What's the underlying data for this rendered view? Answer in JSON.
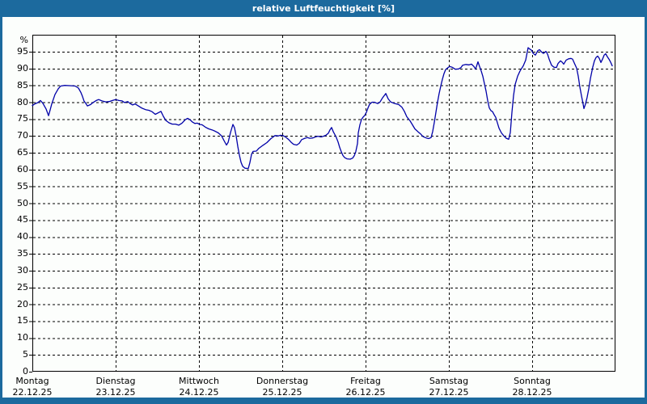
{
  "window": {
    "title": "relative Luftfeuchtigkeit [%]",
    "frame_color": "#1c6a9e",
    "content_background": "#fcfefc"
  },
  "chart_data": {
    "type": "line",
    "title": "relative Luftfeuchtigkeit [%]",
    "unit_label": "%",
    "ylabel": "relative Luftfeuchtigkeit [%]",
    "xlabel": "",
    "ylim": [
      0,
      100
    ],
    "y_ticks": [
      0,
      5,
      10,
      15,
      20,
      25,
      30,
      35,
      40,
      45,
      50,
      55,
      60,
      65,
      70,
      75,
      80,
      85,
      90,
      95
    ],
    "grid": "dashed-black",
    "legend": "none",
    "line_color": "#0000a8",
    "x_axis": {
      "days": [
        {
          "name": "Montag",
          "date": "22.12.25"
        },
        {
          "name": "Dienstag",
          "date": "23.12.25"
        },
        {
          "name": "Mittwoch",
          "date": "24.12.25"
        },
        {
          "name": "Donnerstag",
          "date": "25.12.25"
        },
        {
          "name": "Freitag",
          "date": "26.12.25"
        },
        {
          "name": "Samstag",
          "date": "27.12.25"
        },
        {
          "name": "Sonntag",
          "date": "28.12.25"
        }
      ]
    },
    "series": [
      {
        "name": "relative Luftfeuchtigkeit",
        "x_unit": "days since Montag 22.12.25 00:00",
        "y_unit": "%",
        "points": [
          [
            0.0,
            79.0
          ],
          [
            0.029,
            79.5
          ],
          [
            0.068,
            79.9
          ],
          [
            0.097,
            80.5
          ],
          [
            0.126,
            79.7
          ],
          [
            0.165,
            78.0
          ],
          [
            0.194,
            76.0
          ],
          [
            0.214,
            77.7
          ],
          [
            0.233,
            79.5
          ],
          [
            0.272,
            82.3
          ],
          [
            0.311,
            84.0
          ],
          [
            0.34,
            84.8
          ],
          [
            0.388,
            85.0
          ],
          [
            0.466,
            84.9
          ],
          [
            0.515,
            84.8
          ],
          [
            0.553,
            84.2
          ],
          [
            0.583,
            82.9
          ],
          [
            0.602,
            81.7
          ],
          [
            0.621,
            80.3
          ],
          [
            0.641,
            79.7
          ],
          [
            0.66,
            78.9
          ],
          [
            0.699,
            79.3
          ],
          [
            0.728,
            79.9
          ],
          [
            0.767,
            80.5
          ],
          [
            0.796,
            80.8
          ],
          [
            0.835,
            80.4
          ],
          [
            0.883,
            80.1
          ],
          [
            0.922,
            80.2
          ],
          [
            0.961,
            80.5
          ],
          [
            1.0,
            80.8
          ],
          [
            1.039,
            80.5
          ],
          [
            1.078,
            80.4
          ],
          [
            1.107,
            79.9
          ],
          [
            1.146,
            80.2
          ],
          [
            1.175,
            79.6
          ],
          [
            1.204,
            79.2
          ],
          [
            1.233,
            79.5
          ],
          [
            1.272,
            78.9
          ],
          [
            1.311,
            78.3
          ],
          [
            1.359,
            77.8
          ],
          [
            1.398,
            77.6
          ],
          [
            1.437,
            77.2
          ],
          [
            1.476,
            76.4
          ],
          [
            1.515,
            76.9
          ],
          [
            1.544,
            77.3
          ],
          [
            1.573,
            75.8
          ],
          [
            1.602,
            74.6
          ],
          [
            1.641,
            73.9
          ],
          [
            1.68,
            73.5
          ],
          [
            1.718,
            73.5
          ],
          [
            1.757,
            73.2
          ],
          [
            1.796,
            73.8
          ],
          [
            1.835,
            74.8
          ],
          [
            1.864,
            75.2
          ],
          [
            1.893,
            74.8
          ],
          [
            1.922,
            74.1
          ],
          [
            1.951,
            73.7
          ],
          [
            1.981,
            73.8
          ],
          [
            2.01,
            73.4
          ],
          [
            2.039,
            73.3
          ],
          [
            2.078,
            72.6
          ],
          [
            2.117,
            72.1
          ],
          [
            2.155,
            71.8
          ],
          [
            2.194,
            71.4
          ],
          [
            2.233,
            70.9
          ],
          [
            2.272,
            70.0
          ],
          [
            2.301,
            68.6
          ],
          [
            2.33,
            67.3
          ],
          [
            2.35,
            68.1
          ],
          [
            2.379,
            71.0
          ],
          [
            2.408,
            73.4
          ],
          [
            2.427,
            72.4
          ],
          [
            2.447,
            70.0
          ],
          [
            2.466,
            66.9
          ],
          [
            2.485,
            64.3
          ],
          [
            2.505,
            62.2
          ],
          [
            2.524,
            61.0
          ],
          [
            2.553,
            60.4
          ],
          [
            2.592,
            60.3
          ],
          [
            2.611,
            62.0
          ],
          [
            2.631,
            64.5
          ],
          [
            2.65,
            65.4
          ],
          [
            2.689,
            65.5
          ],
          [
            2.718,
            66.3
          ],
          [
            2.767,
            67.2
          ],
          [
            2.816,
            68.0
          ],
          [
            2.864,
            69.2
          ],
          [
            2.913,
            70.1
          ],
          [
            2.951,
            70.0
          ],
          [
            2.981,
            70.2
          ],
          [
            3.01,
            70.1
          ],
          [
            3.039,
            69.7
          ],
          [
            3.078,
            68.9
          ],
          [
            3.107,
            68.1
          ],
          [
            3.136,
            67.5
          ],
          [
            3.175,
            67.3
          ],
          [
            3.204,
            67.8
          ],
          [
            3.233,
            68.9
          ],
          [
            3.272,
            69.3
          ],
          [
            3.301,
            69.5
          ],
          [
            3.33,
            69.3
          ],
          [
            3.369,
            69.4
          ],
          [
            3.398,
            69.7
          ],
          [
            3.427,
            69.9
          ],
          [
            3.466,
            69.7
          ],
          [
            3.495,
            69.9
          ],
          [
            3.524,
            70.2
          ],
          [
            3.553,
            70.8
          ],
          [
            3.573,
            71.8
          ],
          [
            3.592,
            72.5
          ],
          [
            3.612,
            71.3
          ],
          [
            3.631,
            70.4
          ],
          [
            3.65,
            69.5
          ],
          [
            3.67,
            68.2
          ],
          [
            3.689,
            66.6
          ],
          [
            3.709,
            65.3
          ],
          [
            3.728,
            64.2
          ],
          [
            3.748,
            63.6
          ],
          [
            3.777,
            63.2
          ],
          [
            3.816,
            63.1
          ],
          [
            3.845,
            63.4
          ],
          [
            3.864,
            64.1
          ],
          [
            3.883,
            65.3
          ],
          [
            3.903,
            67.7
          ],
          [
            3.913,
            70.9
          ],
          [
            3.932,
            73.3
          ],
          [
            3.951,
            74.9
          ],
          [
            3.971,
            75.6
          ],
          [
            3.99,
            76.1
          ],
          [
            4.01,
            77.0
          ],
          [
            4.029,
            78.3
          ],
          [
            4.049,
            79.4
          ],
          [
            4.078,
            80.0
          ],
          [
            4.107,
            80.0
          ],
          [
            4.146,
            79.6
          ],
          [
            4.175,
            80.1
          ],
          [
            4.204,
            81.3
          ],
          [
            4.243,
            82.6
          ],
          [
            4.272,
            81.0
          ],
          [
            4.301,
            80.1
          ],
          [
            4.34,
            79.7
          ],
          [
            4.369,
            79.5
          ],
          [
            4.398,
            79.3
          ],
          [
            4.437,
            78.5
          ],
          [
            4.466,
            77.3
          ],
          [
            4.495,
            75.7
          ],
          [
            4.534,
            74.5
          ],
          [
            4.563,
            73.3
          ],
          [
            4.592,
            72.1
          ],
          [
            4.631,
            71.2
          ],
          [
            4.66,
            70.6
          ],
          [
            4.689,
            69.8
          ],
          [
            4.728,
            69.4
          ],
          [
            4.757,
            69.2
          ],
          [
            4.786,
            69.5
          ],
          [
            4.806,
            71.3
          ],
          [
            4.825,
            74.0
          ],
          [
            4.845,
            77.0
          ],
          [
            4.864,
            80.0
          ],
          [
            4.883,
            82.5
          ],
          [
            4.903,
            84.8
          ],
          [
            4.922,
            86.8
          ],
          [
            4.942,
            88.5
          ],
          [
            4.961,
            89.7
          ],
          [
            4.99,
            90.3
          ],
          [
            5.01,
            90.6
          ],
          [
            5.039,
            90.4
          ],
          [
            5.078,
            89.8
          ],
          [
            5.117,
            89.9
          ],
          [
            5.146,
            90.3
          ],
          [
            5.165,
            91.0
          ],
          [
            5.204,
            91.2
          ],
          [
            5.243,
            91.1
          ],
          [
            5.272,
            91.3
          ],
          [
            5.301,
            90.6
          ],
          [
            5.32,
            89.8
          ],
          [
            5.35,
            92.0
          ],
          [
            5.369,
            90.6
          ],
          [
            5.388,
            89.3
          ],
          [
            5.408,
            87.7
          ],
          [
            5.427,
            85.5
          ],
          [
            5.447,
            83.3
          ],
          [
            5.466,
            80.5
          ],
          [
            5.485,
            78.3
          ],
          [
            5.505,
            77.5
          ],
          [
            5.524,
            77.2
          ],
          [
            5.544,
            76.3
          ],
          [
            5.563,
            75.5
          ],
          [
            5.583,
            73.9
          ],
          [
            5.602,
            72.3
          ],
          [
            5.631,
            70.9
          ],
          [
            5.66,
            70.0
          ],
          [
            5.689,
            69.3
          ],
          [
            5.718,
            69.0
          ],
          [
            5.738,
            71.0
          ],
          [
            5.757,
            77.0
          ],
          [
            5.777,
            82.0
          ],
          [
            5.796,
            85.3
          ],
          [
            5.825,
            87.7
          ],
          [
            5.854,
            89.3
          ],
          [
            5.893,
            90.8
          ],
          [
            5.922,
            92.5
          ],
          [
            5.951,
            96.2
          ],
          [
            5.971,
            95.8
          ],
          [
            5.99,
            95.5
          ],
          [
            6.01,
            94.6
          ],
          [
            6.039,
            94.0
          ],
          [
            6.068,
            95.3
          ],
          [
            6.087,
            95.6
          ],
          [
            6.117,
            94.8
          ],
          [
            6.136,
            94.5
          ],
          [
            6.165,
            95.1
          ],
          [
            6.184,
            94.3
          ],
          [
            6.204,
            92.8
          ],
          [
            6.233,
            91.0
          ],
          [
            6.262,
            90.4
          ],
          [
            6.291,
            90.3
          ],
          [
            6.311,
            91.5
          ],
          [
            6.34,
            92.3
          ],
          [
            6.359,
            91.9
          ],
          [
            6.379,
            91.3
          ],
          [
            6.408,
            92.5
          ],
          [
            6.437,
            92.9
          ],
          [
            6.466,
            93.0
          ],
          [
            6.485,
            92.8
          ],
          [
            6.505,
            91.7
          ],
          [
            6.534,
            90.1
          ],
          [
            6.553,
            87.7
          ],
          [
            6.573,
            84.5
          ],
          [
            6.592,
            81.9
          ],
          [
            6.612,
            79.5
          ],
          [
            6.621,
            78.1
          ],
          [
            6.641,
            79.5
          ],
          [
            6.66,
            81.5
          ],
          [
            6.68,
            84.0
          ],
          [
            6.699,
            87.0
          ],
          [
            6.728,
            90.5
          ],
          [
            6.748,
            92.3
          ],
          [
            6.767,
            93.3
          ],
          [
            6.786,
            93.7
          ],
          [
            6.806,
            93.0
          ],
          [
            6.825,
            91.8
          ],
          [
            6.845,
            92.8
          ],
          [
            6.864,
            94.0
          ],
          [
            6.883,
            94.4
          ],
          [
            6.903,
            93.5
          ],
          [
            6.922,
            92.8
          ],
          [
            6.942,
            91.9
          ],
          [
            6.961,
            90.8
          ]
        ]
      }
    ]
  }
}
